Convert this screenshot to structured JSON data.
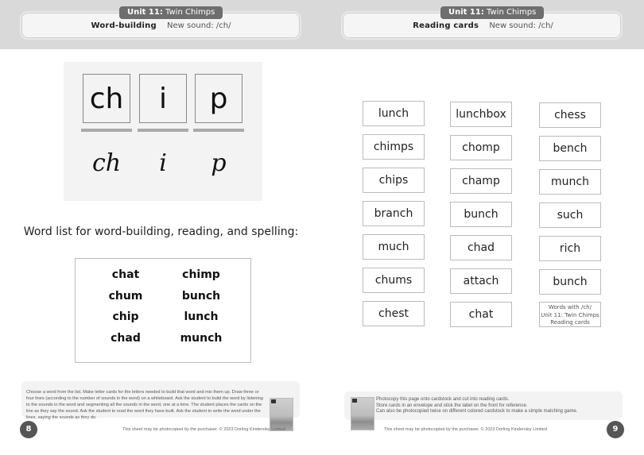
{
  "left_page": {
    "header": {
      "unit_label": "Unit 11:",
      "unit_name": "Twin Chimps",
      "activity": "Word-building",
      "new_sound": "New sound: /ch/"
    },
    "word_building": {
      "tiles": [
        "ch",
        "i",
        "p"
      ],
      "script_letters": [
        "ch",
        "i",
        "p"
      ]
    },
    "word_list": {
      "heading": "Word list for word-building, reading, and spelling:",
      "column_1": [
        "chat",
        "chum",
        "chip",
        "chad"
      ],
      "column_2": [
        "chimp",
        "bunch",
        "lunch",
        "munch"
      ]
    },
    "instructions": "Choose a word from the list. Make letter cards for the letters needed to build that word and mix them up. Draw three or four lines (according to the number of sounds in the word) on a whiteboard. Ask the student to build the word by listening to the sounds in the word and segmenting all the sounds in the word, one at a time. The student places the cards on the line as they say the sound. Ask the student to read the word they have built. Ask the student to write the word under the lines, saying the sounds as they do.",
    "footer_credit": "This sheet may be photocopied by the purchaser. © 2023 Dorling Kindersley Limited",
    "page_number": "8"
  },
  "right_page": {
    "header": {
      "unit_label": "Unit 11:",
      "unit_name": "Twin Chimps",
      "activity": "Reading cards",
      "new_sound": "New sound: /ch/"
    },
    "cards": {
      "column_1": [
        "lunch",
        "chimps",
        "chips",
        "branch",
        "much",
        "chums",
        "chest"
      ],
      "column_2": [
        "lunchbox",
        "chomp",
        "champ",
        "bunch",
        "chad",
        "attach",
        "chat"
      ],
      "column_3": [
        "chess",
        "bench",
        "munch",
        "such",
        "rich",
        "bunch"
      ]
    },
    "label_card": [
      "Words with /ch/",
      "Unit 11: Twin Chimps",
      "Reading cards"
    ],
    "instructions": [
      "Photocopy this page onto cardstock and cut into reading cards.",
      "Store cards in an envelope and stick the label on the front for reference.",
      "Can also be photocopied twice on different colored cardstock to make a simple matching game."
    ],
    "footer_credit": "This sheet may be photocopied by the purchaser. © 2023 Dorling Kindersley Limited",
    "page_number": "9"
  }
}
